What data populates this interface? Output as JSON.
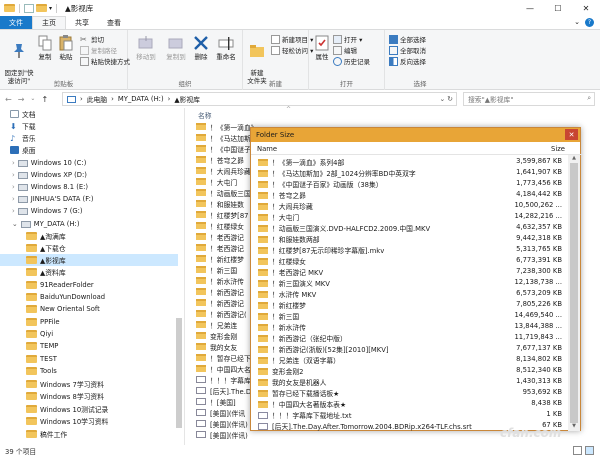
{
  "window": {
    "title": "▲影视库"
  },
  "tabs": [
    "文件",
    "主页",
    "共享",
    "查看"
  ],
  "ribbon": {
    "clipboard": {
      "label": "剪贴板",
      "pin": "固定到\"快\n速访问\"",
      "copy": "复制",
      "paste": "粘贴",
      "copy_path": "复制路径",
      "paste_shortcut": "粘贴快捷方式",
      "cut": "剪切"
    },
    "organize": {
      "label": "组织",
      "move_to": "移动到",
      "copy_to": "复制到",
      "delete": "删除",
      "rename": "重命名"
    },
    "new": {
      "label": "新建",
      "new_folder": "新建\n文件夹",
      "new_item": "新建项目 ▾",
      "easy_access": "轻松访问 ▾"
    },
    "open": {
      "label": "打开",
      "properties": "属性",
      "open": "打开 ▾",
      "edit": "编辑",
      "history": "历史记录"
    },
    "select": {
      "label": "选择",
      "select_all": "全部选择",
      "select_none": "全部取消",
      "invert": "反向选择"
    }
  },
  "address": {
    "path": [
      "此电脑",
      "MY_DATA (H:)",
      "▲影视库"
    ],
    "search_placeholder": "搜索\"▲影视库\""
  },
  "navpane": [
    "文档",
    "下载",
    "音乐",
    "桌面",
    "Windows 10 (C:)",
    "Windows XP (D:)",
    "Windows 8.1 (E:)",
    "JINHUA'S DATA (F:)",
    "Windows 7 (G:)",
    "MY_DATA (H:)",
    "▲淘满库",
    "▲下载仓",
    "▲影视库",
    "▲资料库",
    "91ReaderFolder",
    "BaiduYunDownload",
    "New Oriental Soft",
    "PPFile",
    "Qiyi",
    "TEMP",
    "TEST",
    "Tools",
    "Windows 7学习资料",
    "Windows 8学习资料",
    "Windows 10测试记录",
    "Windows 10学习资料",
    "稿件工作"
  ],
  "filelist": {
    "header_name": "名称",
    "rows": [
      "！《第一滴血》",
      "！《马达加斯加",
      "！《中国谜子",
      "！苍穹之昴",
      "！大闹兵珍藏",
      "！大屯门",
      "！动画版三国",
      "！和服娃数",
      "！红楼梦[87",
      "！红楼绿女",
      "！老西游记",
      "！老西游记",
      "！新红楼梦",
      "！新三国",
      "！新水浒传",
      "！新西游记",
      "！新西游记",
      "！新西游记(",
      "！兄弟连",
      "变形金刚",
      "我的女友",
      "！暂存已经下",
      "！中国四大名著",
      "！！！字幕库",
      "[后天].The.Da",
      "！[美国]",
      "[美国](伴讯",
      "[美国](伴讯)",
      "[美国](伴讯)"
    ]
  },
  "status": {
    "count": "39 个项目"
  },
  "dialog": {
    "title": "Folder Size",
    "col_name": "Name",
    "col_size": "Size",
    "rows": [
      {
        "name": "！《第一滴血》系列4部",
        "size": "3,599,867 KB"
      },
      {
        "name": "！《马达加斯加》2部_1024分辨率BD中英双字",
        "size": "1,641,907 KB"
      },
      {
        "name": "！《中国谜子百家》动画版（38集）",
        "size": "1,773,456 KB"
      },
      {
        "name": "！苍穹之昴",
        "size": "4,184,442 KB"
      },
      {
        "name": "！大闹兵珍藏",
        "size": "10,500,262 ..."
      },
      {
        "name": "！大屯门",
        "size": "14,282,216 ..."
      },
      {
        "name": "！动画版三国演义.DVD-HALFCD2.2009.中国.MKV",
        "size": "4,632,357 KB"
      },
      {
        "name": "！和服娃数两部",
        "size": "9,442,318 KB"
      },
      {
        "name": "！红楼梦[87无示印稀珍字幕版].mkv",
        "size": "5,313,765 KB"
      },
      {
        "name": "！红楼绿女",
        "size": "6,773,391 KB"
      },
      {
        "name": "！老西游记 MKV",
        "size": "7,238,300 KB"
      },
      {
        "name": "！新三国演义 MKV",
        "size": "12,138,738 ..."
      },
      {
        "name": "！水浒传 MKV",
        "size": "6,573,209 KB"
      },
      {
        "name": "！新红楼梦",
        "size": "7,805,226 KB"
      },
      {
        "name": "！新三国",
        "size": "14,469,540 ..."
      },
      {
        "name": "！新水浒传",
        "size": "13,844,388 ..."
      },
      {
        "name": "！新西游记（张纪中版）",
        "size": "11,719,843 ..."
      },
      {
        "name": "！新西游记(浙版)[52集][2010][MKV]",
        "size": "7,677,137 KB"
      },
      {
        "name": "！兄弟连（双语字幕）",
        "size": "8,134,802 KB"
      },
      {
        "name": "变形金刚2",
        "size": "8,512,340 KB"
      },
      {
        "name": "我的女友是机器人",
        "size": "1,430,313 KB"
      },
      {
        "name": "暂存已经下载播话板★",
        "size": "953,692 KB"
      },
      {
        "name": "！中国四大名著版本表★",
        "size": "8,438 KB"
      },
      {
        "name": "！！！字幕库下载地址.txt",
        "size": "1 KB"
      },
      {
        "name": "[后天].The.Day.After.Tomorrow.2004.BDRip.x264-TLF.chs.srt",
        "size": "67 KB"
      }
    ]
  },
  "watermark": "cfan.com"
}
